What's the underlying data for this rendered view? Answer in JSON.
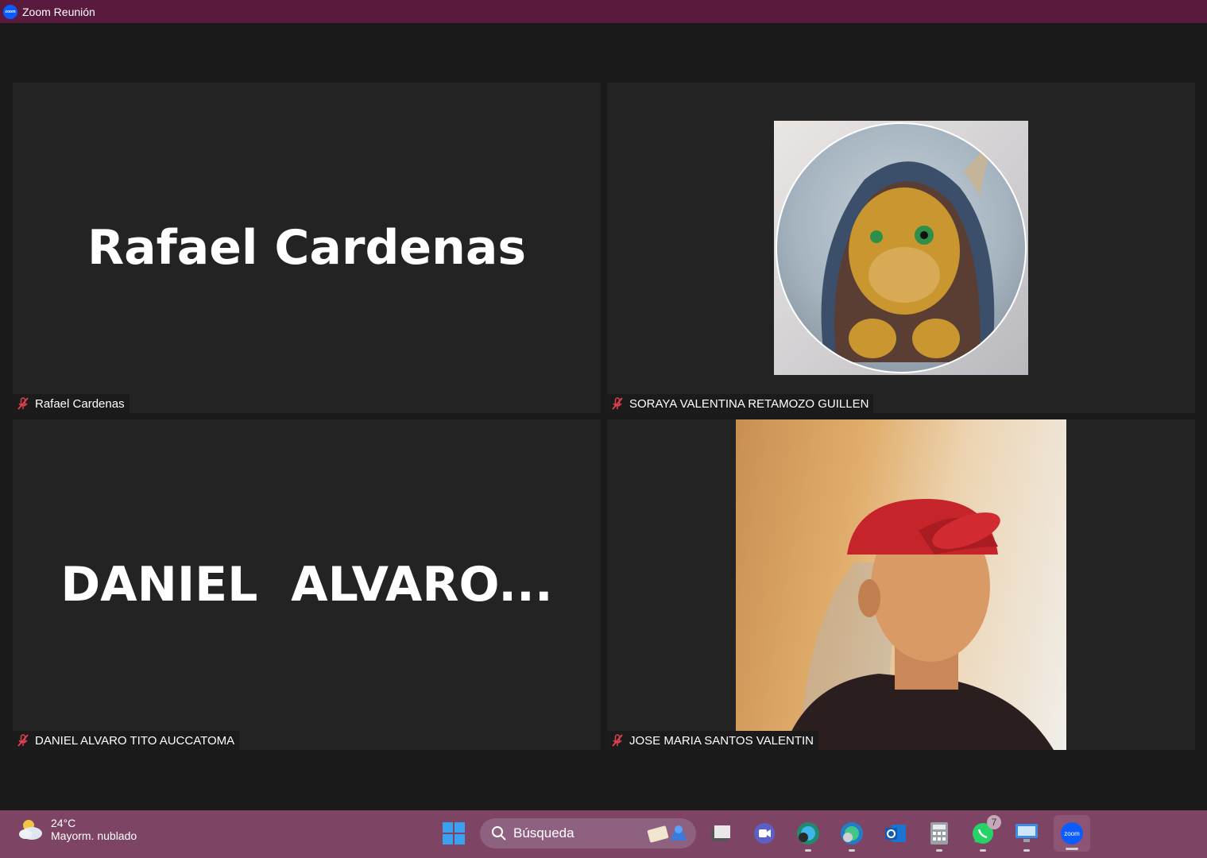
{
  "window": {
    "title": "Zoom Reunión"
  },
  "tiles": [
    {
      "display_name": "Rafael Cardenas",
      "tag": "Rafael Cardenas",
      "mic": "muted"
    },
    {
      "display_name": "",
      "tag": "SORAYA VALENTINA RETAMOZO GUILLEN",
      "mic": "muted",
      "avatar": "dragon-avatar-image"
    },
    {
      "display_name": "DANIEL  ALVARO...",
      "tag": "DANIEL ALVARO TITO AUCCATOMA",
      "mic": "muted"
    },
    {
      "display_name": "",
      "tag": "JOSE MARIA SANTOS VALENTIN",
      "mic": "muted",
      "avatar": "person-photo-image"
    }
  ],
  "taskbar": {
    "weather": {
      "temp": "24°C",
      "condition": "Mayorm. nublado"
    },
    "search_placeholder": "Búsqueda",
    "whatsapp_badge": "7",
    "icons": [
      "start-icon",
      "search-icon",
      "task-view-icon",
      "teams-icon",
      "edge-dev-icon",
      "edge-icon",
      "outlook-icon",
      "calculator-icon",
      "whatsapp-icon",
      "remote-desktop-icon",
      "zoom-icon"
    ]
  },
  "colors": {
    "titlebar": "#5a1a3e",
    "taskbar": "#7d4563",
    "tile_bg": "#232323",
    "muted_mic": "#e0414f",
    "zoom_blue": "#0b5cff"
  }
}
